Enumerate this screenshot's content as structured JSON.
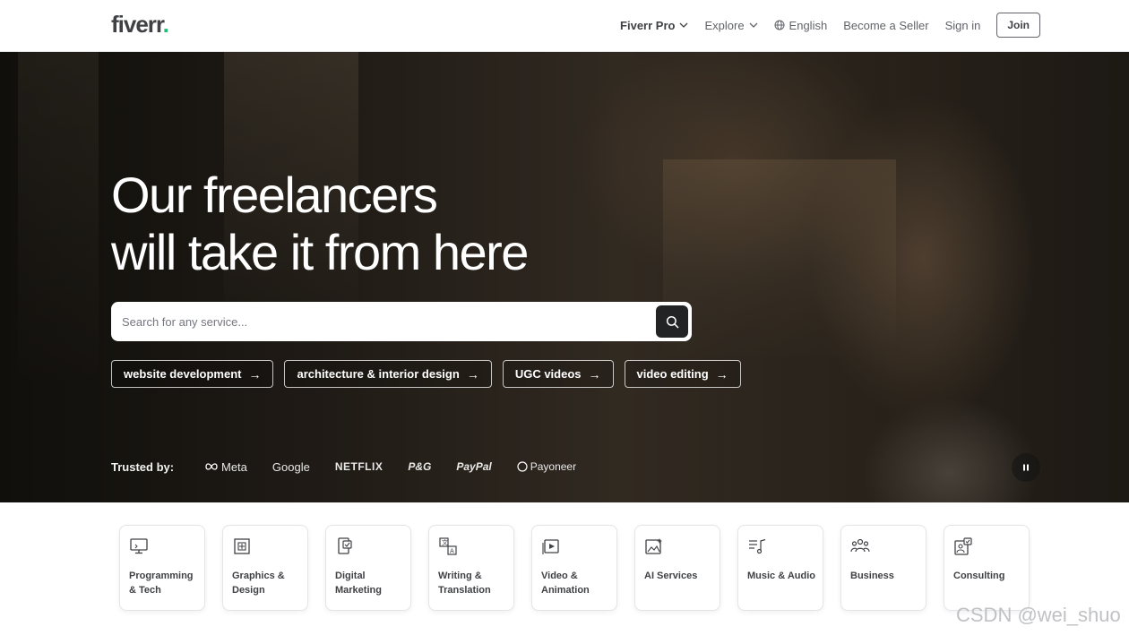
{
  "header": {
    "logo": "fiverr",
    "logo_dot": ".",
    "nav": {
      "fiverr_pro": "Fiverr Pro",
      "explore": "Explore",
      "language": "English",
      "become_seller": "Become a Seller",
      "sign_in": "Sign in",
      "join": "Join"
    }
  },
  "hero": {
    "title_line1": "Our freelancers",
    "title_line2": "will take it from here",
    "search": {
      "placeholder": "Search for any service..."
    },
    "chips": [
      {
        "label": "website development"
      },
      {
        "label": "architecture & interior design"
      },
      {
        "label": "UGC videos"
      },
      {
        "label": "video editing"
      }
    ],
    "chip_arrow": "→",
    "trusted_label": "Trusted by:",
    "brands": [
      "Meta",
      "Google",
      "NETFLIX",
      "P&G",
      "PayPal",
      "Payoneer"
    ]
  },
  "categories": [
    {
      "label": "Programming & Tech",
      "icon": "monitor-icon"
    },
    {
      "label": "Graphics & Design",
      "icon": "design-icon"
    },
    {
      "label": "Digital Marketing",
      "icon": "marketing-icon"
    },
    {
      "label": "Writing & Translation",
      "icon": "translation-icon"
    },
    {
      "label": "Video & Animation",
      "icon": "video-icon"
    },
    {
      "label": "AI Services",
      "icon": "ai-icon"
    },
    {
      "label": "Music & Audio",
      "icon": "music-icon"
    },
    {
      "label": "Business",
      "icon": "people-icon"
    },
    {
      "label": "Consulting",
      "icon": "consulting-icon"
    }
  ],
  "watermark": "CSDN @wei_shuo",
  "colors": {
    "brand_green": "#1dbf73",
    "dark": "#222325",
    "muted": "#62646a"
  }
}
